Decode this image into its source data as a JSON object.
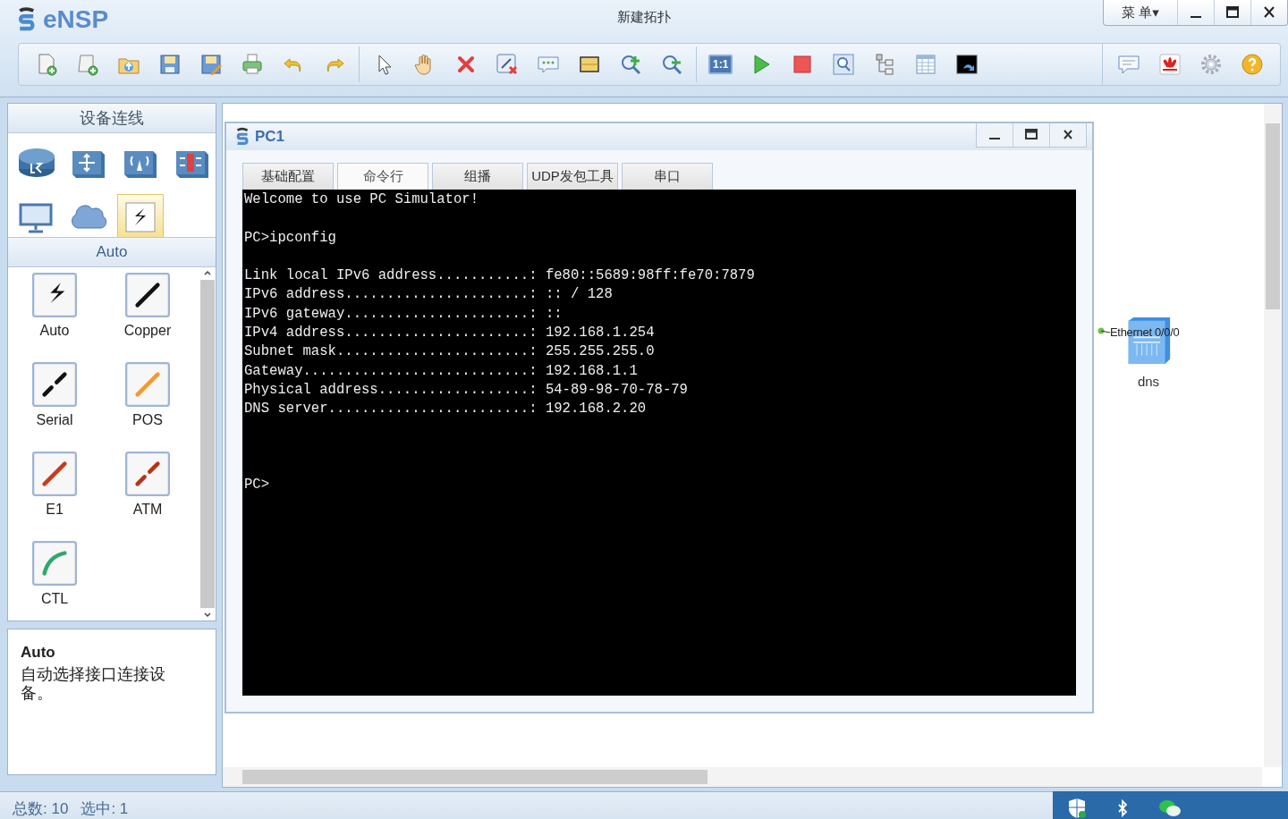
{
  "app": {
    "logo": "eNSP",
    "title": "新建拓扑",
    "menu_button": "菜 单▾"
  },
  "toolbar": {
    "actual_size_label": "1:1"
  },
  "left_panel": {
    "header": "设备连线",
    "device_categories": [
      {
        "selected": false
      },
      {
        "selected": false
      },
      {
        "selected": false
      },
      {
        "selected": false
      },
      {
        "selected": false
      },
      {
        "selected": false
      },
      {
        "selected": true
      }
    ],
    "category_title": "Auto",
    "cables": [
      {
        "label": "Auto",
        "kind": "auto"
      },
      {
        "label": "Copper",
        "kind": "copper"
      },
      {
        "label": "Serial",
        "kind": "serial"
      },
      {
        "label": "POS",
        "kind": "pos"
      },
      {
        "label": "E1",
        "kind": "e1"
      },
      {
        "label": "ATM",
        "kind": "atm"
      },
      {
        "label": "CTL",
        "kind": "ctl"
      }
    ],
    "description": {
      "title": "Auto",
      "text": "自动选择接口连接设备。"
    }
  },
  "pc_window": {
    "title": "PC1",
    "tabs": [
      {
        "label": "基础配置",
        "selected": false
      },
      {
        "label": "命令行",
        "selected": true
      },
      {
        "label": "组播",
        "selected": false
      },
      {
        "label": "UDP发包工具",
        "selected": false
      },
      {
        "label": "串口",
        "selected": false
      }
    ],
    "terminal_blocks": [
      [
        "Welcome to use PC Simulator!"
      ],
      [
        "PC>ipconfig"
      ],
      [
        "Link local IPv6 address...........: fe80::5689:98ff:fe70:7879",
        "IPv6 address......................: :: / 128",
        "IPv6 gateway......................: ::",
        "IPv4 address......................: 192.168.1.254",
        "Subnet mask.......................: 255.255.255.0",
        "Gateway...........................: 192.168.1.1",
        "Physical address..................: 54-89-98-70-78-79",
        "DNS server........................: 192.168.2.20"
      ]
    ],
    "terminal_prompt": "PC>"
  },
  "canvas_device": {
    "port_label": "Ethernet 0/0/0",
    "name": "dns"
  },
  "status_bar": {
    "total_label": "总数:",
    "total": "10",
    "selected_label": "选中:",
    "selected": "1"
  }
}
